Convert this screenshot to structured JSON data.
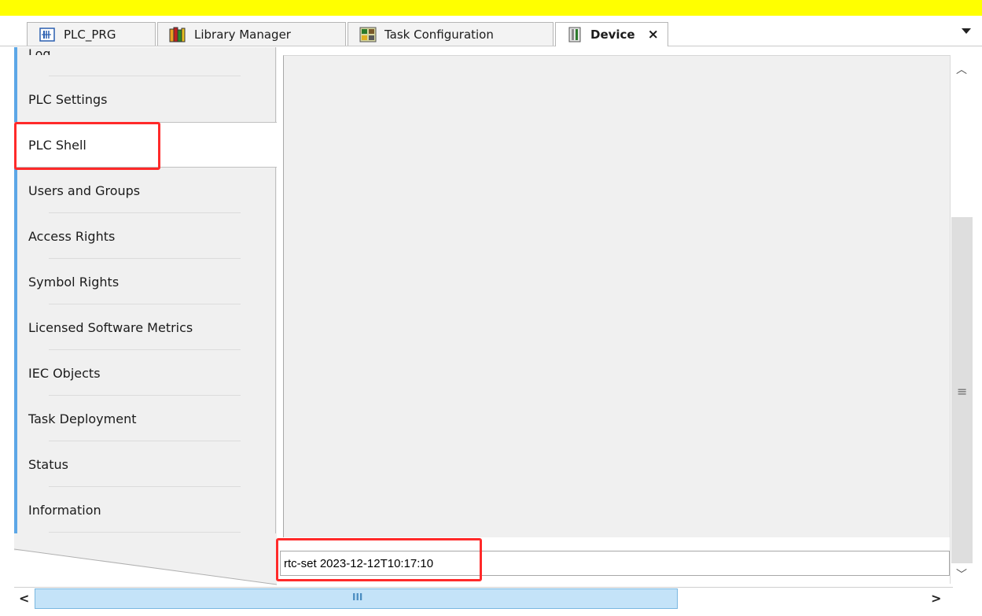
{
  "tabs": [
    {
      "label": "PLC_PRG",
      "icon": "plc-program-icon"
    },
    {
      "label": "Library Manager",
      "icon": "library-books-icon"
    },
    {
      "label": "Task Configuration",
      "icon": "task-configuration-icon"
    },
    {
      "label": "Device",
      "icon": "device-icon",
      "active": true
    }
  ],
  "tab_close_glyph": "×",
  "sidebar": {
    "partial_top_label": "Log",
    "items": [
      {
        "label": "PLC Settings"
      },
      {
        "label": "PLC Shell",
        "selected": true
      },
      {
        "label": "Users and Groups"
      },
      {
        "label": "Access Rights"
      },
      {
        "label": "Symbol Rights"
      },
      {
        "label": "Licensed Software Metrics"
      },
      {
        "label": "IEC Objects"
      },
      {
        "label": "Task Deployment"
      },
      {
        "label": "Status"
      },
      {
        "label": "Information"
      }
    ]
  },
  "shell": {
    "command_input_value": "rtc-set 2023-12-12T10:17:10"
  },
  "colors": {
    "top_bar": "#ffff00",
    "highlight": "#ff2a2a",
    "accent": "#5ca7e6"
  }
}
